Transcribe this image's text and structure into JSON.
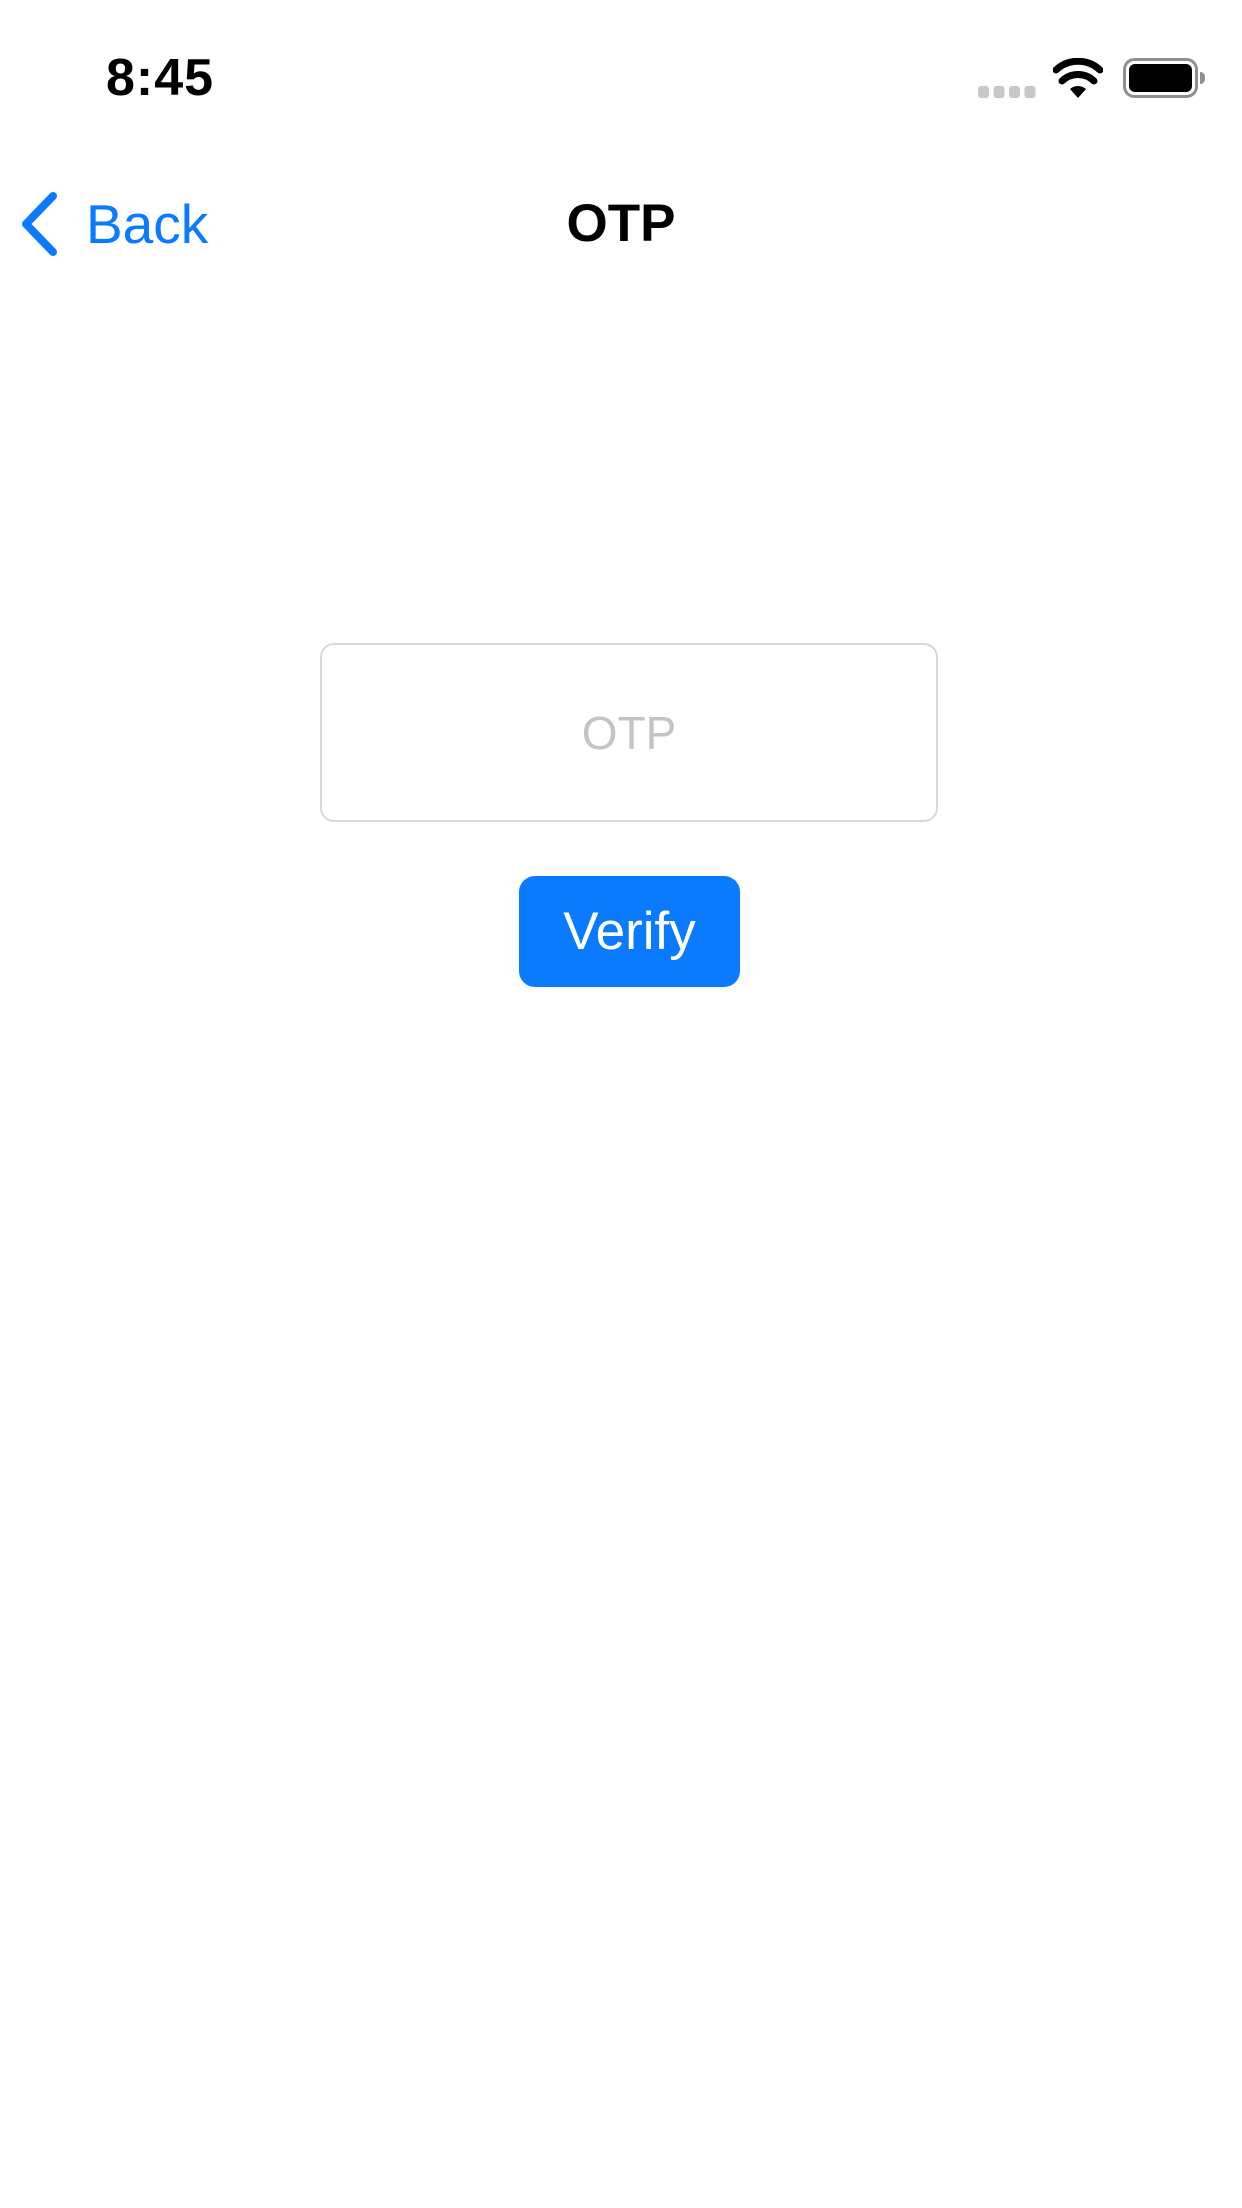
{
  "status_bar": {
    "time": "8:45",
    "icons": [
      "cellular-signal-icon",
      "wifi-icon",
      "battery-icon"
    ]
  },
  "nav": {
    "back_label": "Back",
    "back_icon": "chevron-left-icon",
    "title": "OTP"
  },
  "form": {
    "otp_placeholder": "OTP",
    "otp_value": "",
    "verify_label": "Verify"
  },
  "colors": {
    "accent": "#0a7aff",
    "button_text": "#ffffff",
    "placeholder": "#c4c4c6",
    "input_border": "#d9d9d9",
    "background": "#ffffff"
  }
}
